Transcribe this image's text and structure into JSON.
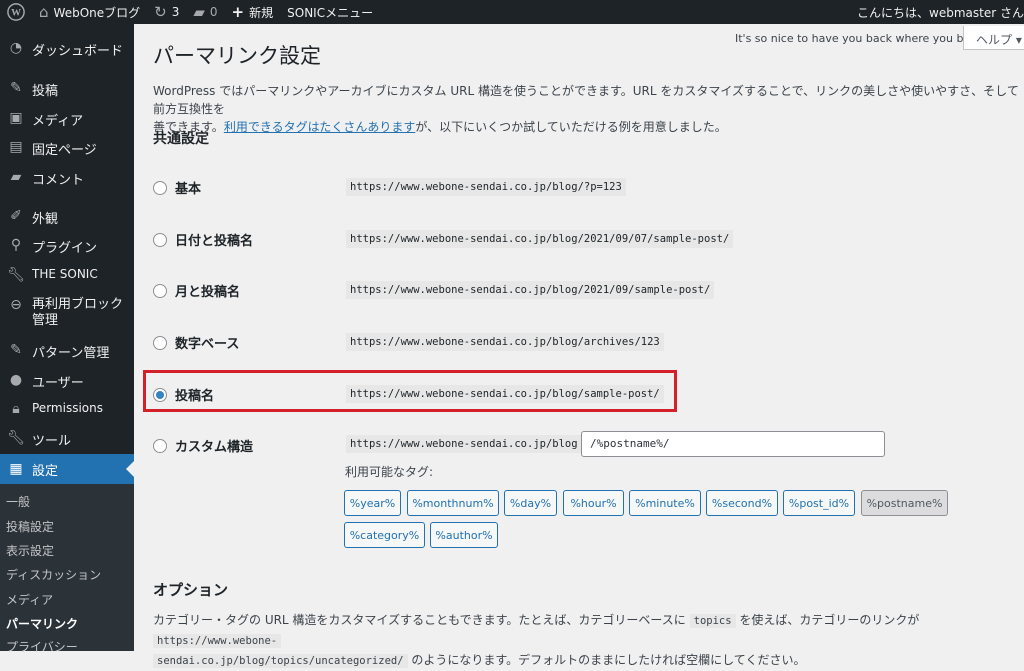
{
  "adminbar": {
    "site_name": "WebOneブログ",
    "updates": "3",
    "comments": "0",
    "new": "新規",
    "sonic_menu": "SONICメニュー",
    "greeting": "こんにちは、webmaster さん"
  },
  "sidebar": {
    "items": [
      {
        "label": "ダッシュボード",
        "icon": "dashboard-icon"
      },
      {
        "label": "投稿",
        "icon": "pin-icon"
      },
      {
        "label": "メディア",
        "icon": "media-icon"
      },
      {
        "label": "固定ページ",
        "icon": "page-icon"
      },
      {
        "label": "コメント",
        "icon": "comment-icon"
      },
      {
        "label": "外観",
        "icon": "brush-icon"
      },
      {
        "label": "プラグイン",
        "icon": "plugin-icon"
      },
      {
        "label": "THE SONIC",
        "icon": "wrench-icon"
      },
      {
        "label": "再利用ブロック管理",
        "icon": "reusable-block-icon"
      },
      {
        "label": "パターン管理",
        "icon": "pin-icon"
      },
      {
        "label": "ユーザー",
        "icon": "user-icon"
      },
      {
        "label": "Permissions",
        "icon": "lock-icon"
      },
      {
        "label": "ツール",
        "icon": "wrench-icon"
      },
      {
        "label": "設定",
        "icon": "settings-icon"
      }
    ],
    "submenu": [
      "一般",
      "投稿設定",
      "表示設定",
      "ディスカッション",
      "メディア",
      "パーマリンク",
      "プライバシー"
    ]
  },
  "main": {
    "title": "パーマリンク設定",
    "welcome": "It's so nice to have you back where you belong",
    "help": "ヘルプ ▾",
    "intro_before": "WordPress ではパーマリンクやアーカイブにカスタム URL 構造を使うことができます。URL をカスタマイズすることで、リンクの美しさや使いやすさ、そして前方互換性を",
    "intro_before2": "善できます。",
    "intro_link": "利用できるタグはたくさんあります",
    "intro_after": "が、以下にいくつか試していただける例を用意しました。",
    "common_heading": "共通設定",
    "options": [
      {
        "label": "基本",
        "url": "https://www.webone-sendai.co.jp/blog/?p=123"
      },
      {
        "label": "日付と投稿名",
        "url": "https://www.webone-sendai.co.jp/blog/2021/09/07/sample-post/"
      },
      {
        "label": "月と投稿名",
        "url": "https://www.webone-sendai.co.jp/blog/2021/09/sample-post/"
      },
      {
        "label": "数字ベース",
        "url": "https://www.webone-sendai.co.jp/blog/archives/123"
      },
      {
        "label": "投稿名",
        "url": "https://www.webone-sendai.co.jp/blog/sample-post/"
      },
      {
        "label": "カスタム構造",
        "url": "https://www.webone-sendai.co.jp/blog"
      }
    ],
    "custom_value": "/%postname%/",
    "tags_label": "利用可能なタグ:",
    "tags": [
      "%year%",
      "%monthnum%",
      "%day%",
      "%hour%",
      "%minute%",
      "%second%",
      "%post_id%",
      "%postname%",
      "%category%",
      "%author%"
    ],
    "options_heading": "オプション",
    "opt_text1": "カテゴリー・タグの URL 構造をカスタマイズすることもできます。たとえば、カテゴリーベースに ",
    "opt_code1": "topics",
    "opt_text2": " を使えば、カテゴリーのリンクが ",
    "opt_code2a": "https://www.webone-",
    "opt_code2b": "sendai.co.jp/blog/topics/uncategorized/",
    "opt_text3": " のようになります。デフォルトのままにしたければ空欄にしてください。"
  }
}
